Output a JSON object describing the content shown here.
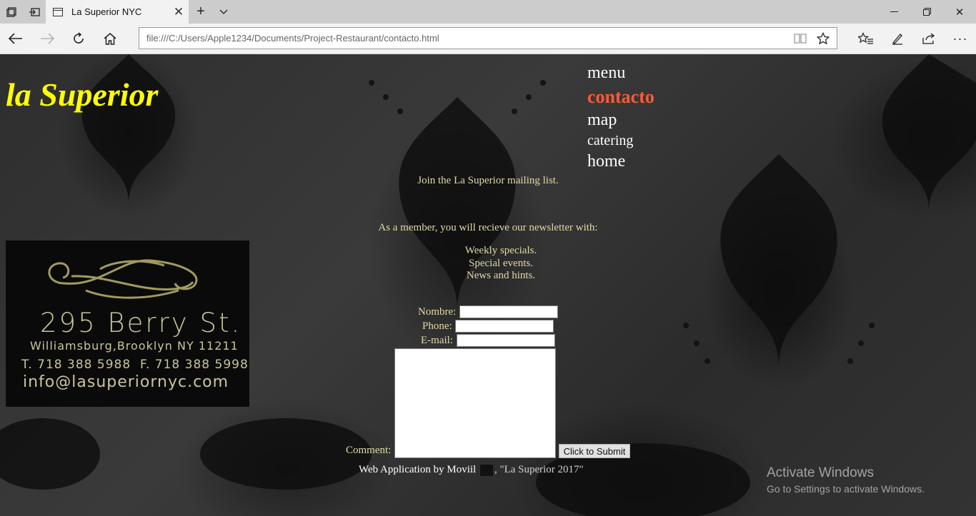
{
  "browser": {
    "tab_title": "La Superior NYC",
    "address_url": "file:///C:/Users/Apple1234/Documents/Project-Restaurant/contacto.html"
  },
  "site": {
    "logo": "la Superior",
    "nav": {
      "menu": "menu",
      "contacto": "contacto",
      "map": "map",
      "catering": "catering",
      "home": "home"
    },
    "active_nav": "contacto",
    "join_text": "Join the La Superior mailing list.",
    "member_text": "As a member, you will recieve our newsletter with:",
    "benefits": [
      "Weekly specials.",
      "Special events.",
      "News and hints."
    ],
    "card": {
      "street": "295 Berry St.",
      "city": "Williamsburg,Brooklyn NY 11211",
      "phone": "T. 718 388 5988  F. 718 388 5998",
      "email": "info@lasuperiornyc.com"
    },
    "form": {
      "name_label": "Nombre:",
      "phone_label": "Phone:",
      "email_label": "E-mail:",
      "comment_label": "Comment:",
      "submit_label": "Click to Submit"
    },
    "footer": {
      "credit": "Web Application by Moviil",
      "year_text": ", \"La Superior 2017\""
    }
  },
  "watermark": {
    "line1": "Activate Windows",
    "line2": "Go to Settings to activate Windows."
  },
  "colors": {
    "logo": "#ffff00",
    "active_nav": "#ff5a36",
    "body_text": "#e0d9a6",
    "card_text": "#c9c59b"
  }
}
